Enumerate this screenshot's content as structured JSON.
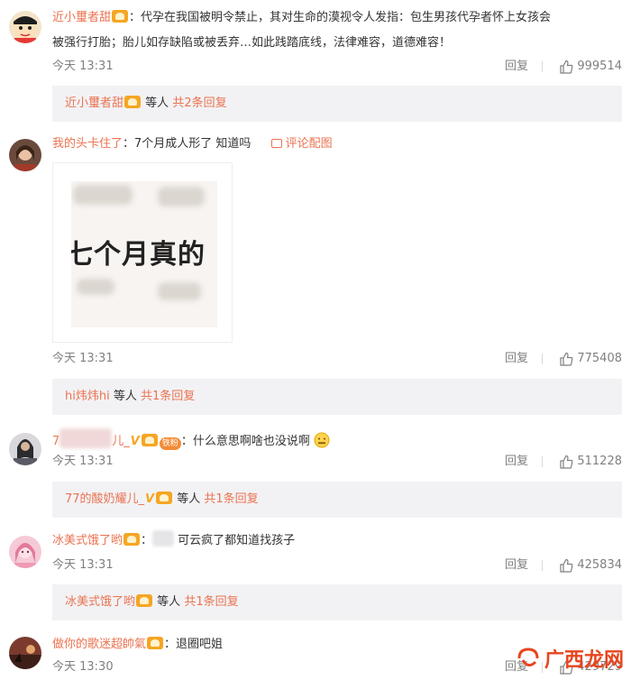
{
  "comments": [
    {
      "username": "近小璽者甜",
      "text_line1": "：代孕在我国被明令禁止，其对生命的漠视令人发指：包生男孩代孕者怀上女孩会",
      "text_line2": "被强行打胎；胎儿如存缺陷或被丢弃…如此践踏底线，法律难容，道德难容！",
      "time": "今天 13:31",
      "reply_label": "回复",
      "likes": "999514",
      "reply_summary": {
        "username": "近小璽者甜",
        "others": "等人",
        "count_text": "共2条回复"
      }
    },
    {
      "username": "我的头卡住了",
      "text": "：7个月成人形了 知道吗",
      "link_text": "评论配图",
      "image_text": "七个月真的",
      "time": "今天 13:31",
      "reply_label": "回复",
      "likes": "775408",
      "reply_summary": {
        "username": "hi炜炜hi",
        "others": "等人",
        "count_text": "共1条回复"
      }
    },
    {
      "username_prefix": "7",
      "username_suffix": "儿_",
      "fan_badge": "铁粉",
      "text": "：什么意思啊啥也没说啊",
      "time": "今天 13:31",
      "reply_label": "回复",
      "likes": "511228",
      "reply_summary": {
        "username": "77的酸奶耀儿_",
        "others": "等人",
        "count_text": "共1条回复"
      }
    },
    {
      "username": "冰美式饿了哟",
      "text": "可云疯了都知道找孩子",
      "time": "今天 13:31",
      "reply_label": "回复",
      "likes": "425834",
      "reply_summary": {
        "username": "冰美式饿了哟",
        "others": "等人",
        "count_text": "共1条回复"
      }
    },
    {
      "username": "做你的歌迷超帥氣",
      "text": "：退圈吧姐",
      "time": "今天 13:30",
      "reply_label": "回复",
      "likes": "429729"
    }
  ],
  "watermark": "广西龙网",
  "icons": {
    "like": "thumb-up-icon",
    "vip": "vip-crown-icon",
    "verified": "v-verified-icon"
  },
  "colors": {
    "username": "#eb7350",
    "meta": "#808080",
    "reply_bg": "#f2f2f5"
  }
}
